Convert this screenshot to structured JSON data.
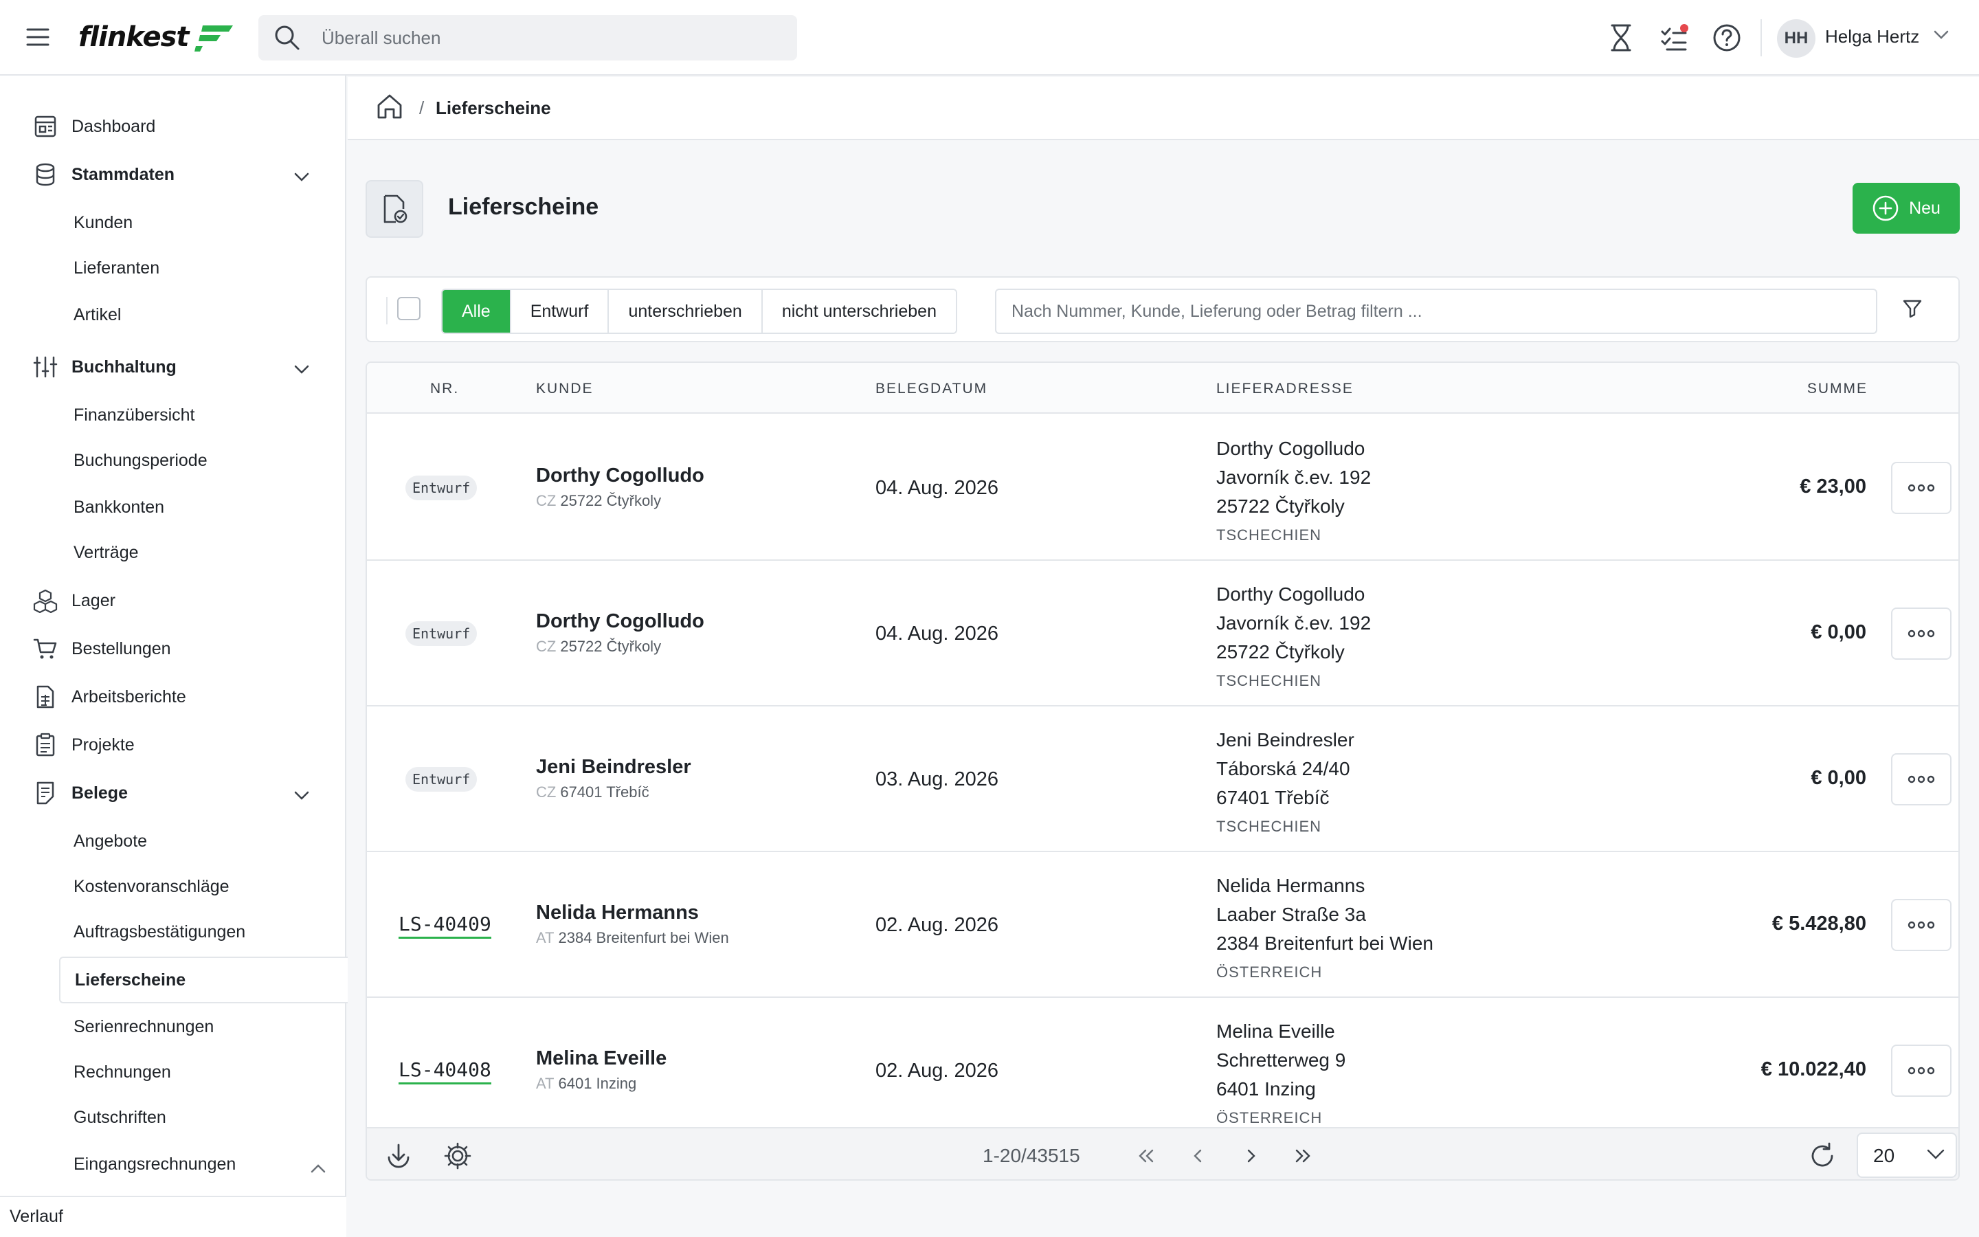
{
  "header": {
    "logo_text": "flinkest",
    "search_placeholder": "Überall suchen",
    "user_initials": "HH",
    "user_name": "Helga Hertz"
  },
  "sidebar": {
    "dashboard": "Dashboard",
    "stammdaten": "Stammdaten",
    "kunden": "Kunden",
    "lieferanten": "Lieferanten",
    "artikel": "Artikel",
    "buchhaltung": "Buchhaltung",
    "finanzuebersicht": "Finanzübersicht",
    "buchungsperiode": "Buchungsperiode",
    "bankkonten": "Bankkonten",
    "vertraege": "Verträge",
    "lager": "Lager",
    "bestellungen": "Bestellungen",
    "arbeitsberichte": "Arbeitsberichte",
    "projekte": "Projekte",
    "belege": "Belege",
    "angebote": "Angebote",
    "kostenvoranschlaege": "Kostenvoranschläge",
    "auftragsbestaetigungen": "Auftragsbestätigungen",
    "lieferscheine": "Lieferscheine",
    "serienrechnungen": "Serienrechnungen",
    "rechnungen": "Rechnungen",
    "gutschriften": "Gutschriften",
    "eingangsrechnungen": "Eingangsrechnungen",
    "verlauf": "Verlauf"
  },
  "breadcrumb": {
    "current": "Lieferscheine",
    "separator": "/"
  },
  "page": {
    "title": "Lieferscheine",
    "new_button": "Neu"
  },
  "filters": {
    "tabs": [
      "Alle",
      "Entwurf",
      "unterschrieben",
      "nicht unterschrieben"
    ],
    "active_tab": "Alle",
    "placeholder": "Nach Nummer, Kunde, Lieferung oder Betrag filtern ..."
  },
  "table": {
    "columns": [
      "NR.",
      "KUNDE",
      "BELEGDATUM",
      "LIEFERADRESSE",
      "SUMME"
    ],
    "rows": [
      {
        "nr": "Entwurf",
        "nr_type": "badge",
        "customer": "Dorthy Cogolludo",
        "country_code": "CZ",
        "customer_city": "25722 Čtyřkoly",
        "date": "04. Aug. 2026",
        "addr1": "Dorthy Cogolludo",
        "addr2": "Javorník č.ev. 192",
        "addr3": "25722 Čtyřkoly",
        "country": "TSCHECHIEN",
        "sum": "€ 23,00"
      },
      {
        "nr": "Entwurf",
        "nr_type": "badge",
        "customer": "Dorthy Cogolludo",
        "country_code": "CZ",
        "customer_city": "25722 Čtyřkoly",
        "date": "04. Aug. 2026",
        "addr1": "Dorthy Cogolludo",
        "addr2": "Javorník č.ev. 192",
        "addr3": "25722 Čtyřkoly",
        "country": "TSCHECHIEN",
        "sum": "€ 0,00"
      },
      {
        "nr": "Entwurf",
        "nr_type": "badge",
        "customer": "Jeni Beindresler",
        "country_code": "CZ",
        "customer_city": "67401 Třebíč",
        "date": "03. Aug. 2026",
        "addr1": "Jeni Beindresler",
        "addr2": "Táborská 24/40",
        "addr3": "67401 Třebíč",
        "country": "TSCHECHIEN",
        "sum": "€ 0,00"
      },
      {
        "nr": "LS-40409",
        "nr_type": "link",
        "customer": "Nelida Hermanns",
        "country_code": "AT",
        "customer_city": "2384 Breitenfurt bei Wien",
        "date": "02. Aug. 2026",
        "addr1": "Nelida Hermanns",
        "addr2": "Laaber Straße 3a",
        "addr3": "2384 Breitenfurt bei Wien",
        "country": "ÖSTERREICH",
        "sum": "€ 5.428,80"
      },
      {
        "nr": "LS-40408",
        "nr_type": "link",
        "customer": "Melina Eveille",
        "country_code": "AT",
        "customer_city": "6401 Inzing",
        "date": "02. Aug. 2026",
        "addr1": "Melina Eveille",
        "addr2": "Schretterweg 9",
        "addr3": "6401 Inzing",
        "country": "ÖSTERREICH",
        "sum": "€ 10.022,40"
      }
    ]
  },
  "pagination": {
    "range_text": "1-20/43515",
    "per_page": "20"
  },
  "colors": {
    "accent": "#2bb24c",
    "notification": "#e5484d"
  }
}
